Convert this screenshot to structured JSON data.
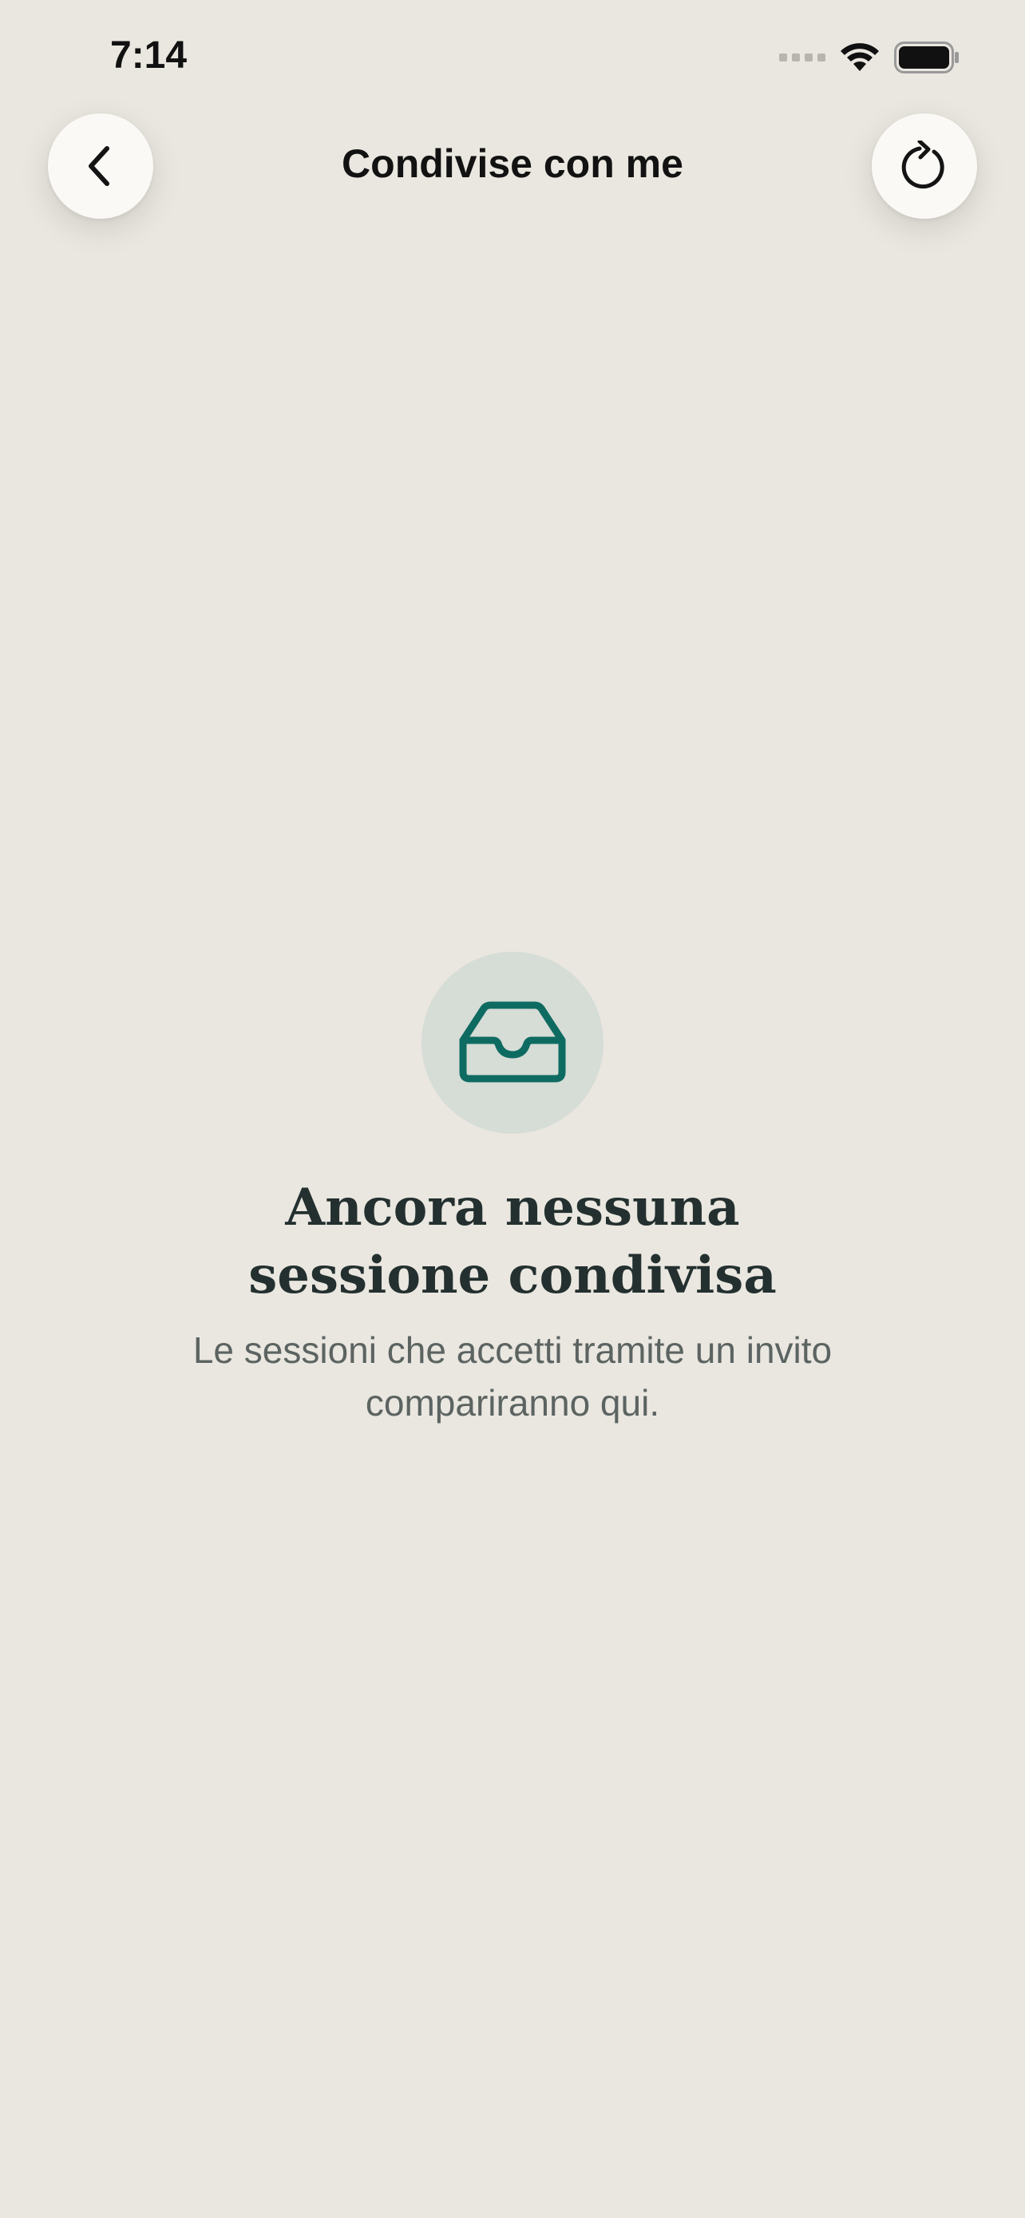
{
  "status_bar": {
    "time": "7:14"
  },
  "header": {
    "title": "Condivise con me",
    "back_icon": "chevron-left-icon",
    "refresh_icon": "refresh-icon"
  },
  "empty_state": {
    "icon": "inbox-tray-icon",
    "title_line1": "Ancora nessuna",
    "title_line2": "sessione condivisa",
    "subtitle": "Le sessioni che accetti tramite un invito compariranno qui."
  },
  "colors": {
    "background": "#EAE7E0",
    "accent": "#0E6B62",
    "icon_circle": "#D6DCD6",
    "title_text": "#23302F",
    "subtitle_text": "#5C6462"
  }
}
